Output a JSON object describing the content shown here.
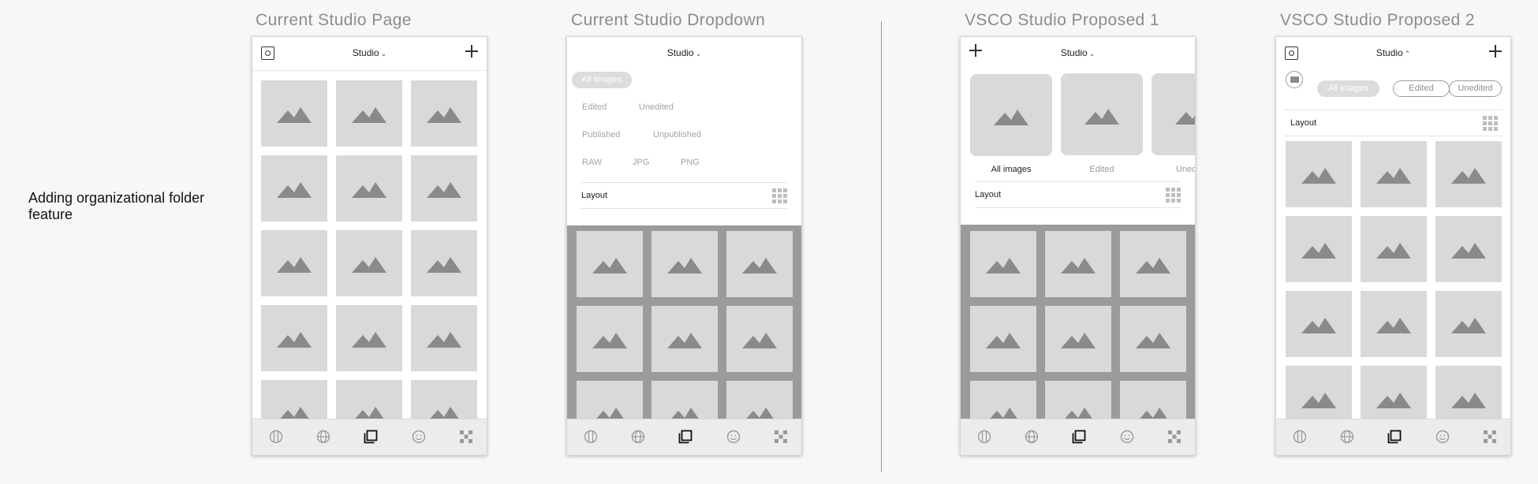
{
  "note": "Adding organizational folder feature",
  "frames": {
    "f1": {
      "title": "Current Studio Page",
      "header": "Studio",
      "chevron": "⌄"
    },
    "f2": {
      "title": "Current Studio Dropdown",
      "header": "Studio",
      "chevron": "⌄",
      "dropdown": {
        "all_images": "All images",
        "edited": "Edited",
        "unedited": "Unedited",
        "published": "Published",
        "unpublished": "Unpublished",
        "raw": "RAW",
        "jpg": "JPG",
        "png": "PNG"
      },
      "layout_label": "Layout"
    },
    "f3": {
      "title": "VSCO Studio Proposed 1",
      "header": "Studio",
      "chevron": "⌄",
      "folders": [
        "All images",
        "Edited",
        "Uned"
      ],
      "layout_label": "Layout"
    },
    "f4": {
      "title": "VSCO Studio Proposed 2",
      "header": "Studio",
      "chevron": "⌃",
      "filters": [
        "All images",
        "Edited",
        "Unedited"
      ],
      "layout_label": "Layout"
    }
  },
  "tab_icons": [
    "feed-icon",
    "discover-icon",
    "studio-icon",
    "profile-icon",
    "camera-grid-icon"
  ],
  "colors": {
    "placeholder": "#d9d9d9",
    "mountain": "#8a8a8a",
    "overlay": "#9b9b9b",
    "tab_active": "#111111",
    "tab_inactive": "#9a9a9a"
  }
}
